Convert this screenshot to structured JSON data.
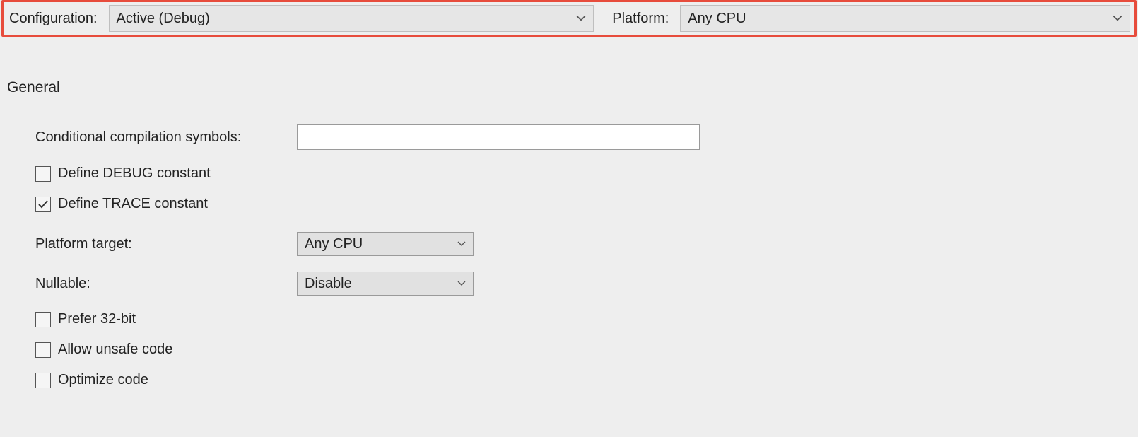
{
  "top": {
    "configuration_label": "Configuration:",
    "configuration_value": "Active (Debug)",
    "platform_label": "Platform:",
    "platform_value": "Any CPU"
  },
  "section": {
    "title": "General"
  },
  "fields": {
    "symbols_label": "Conditional compilation symbols:",
    "symbols_value": "",
    "debug_label": "Define DEBUG constant",
    "debug_checked": false,
    "trace_label": "Define TRACE constant",
    "trace_checked": true,
    "platform_target_label": "Platform target:",
    "platform_target_value": "Any CPU",
    "nullable_label": "Nullable:",
    "nullable_value": "Disable",
    "prefer32_label": "Prefer 32-bit",
    "prefer32_checked": false,
    "unsafe_label": "Allow unsafe code",
    "unsafe_checked": false,
    "optimize_label": "Optimize code",
    "optimize_checked": false
  }
}
